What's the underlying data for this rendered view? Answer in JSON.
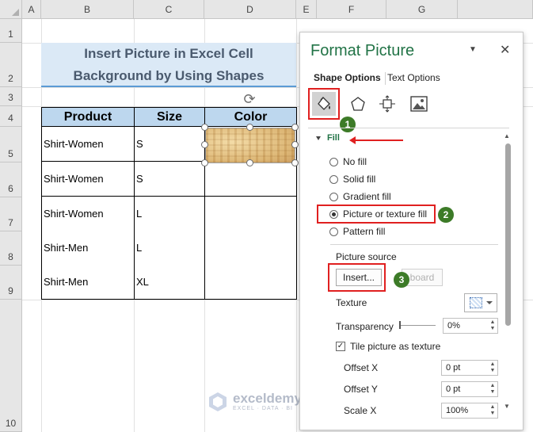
{
  "columns": [
    "A",
    "B",
    "C",
    "D",
    "E",
    "F",
    "G"
  ],
  "rows": [
    "1",
    "2",
    "3",
    "4",
    "5",
    "6",
    "7",
    "8",
    "9",
    "10"
  ],
  "sheet_title_line1": "Insert Picture in Excel Cell",
  "sheet_title_line2": "Background by Using Shapes",
  "table": {
    "headers": [
      "Product",
      "Size",
      "Color"
    ],
    "rows": [
      {
        "product": "Shirt-Women",
        "size": "S"
      },
      {
        "product": "Shirt-Women",
        "size": "S"
      },
      {
        "product": "Shirt-Women",
        "size": "L"
      },
      {
        "product": "Shirt-Men",
        "size": "L"
      },
      {
        "product": "Shirt-Men",
        "size": "XL"
      }
    ]
  },
  "watermark": {
    "name": "exceldemy",
    "tagline": "EXCEL · DATA · BI"
  },
  "pane": {
    "title": "Format Picture",
    "menu_glyph": "▼",
    "close_glyph": "✕",
    "tabs": {
      "shape": "Shape Options",
      "text": "Text Options"
    },
    "fill_section": "Fill",
    "fill_options": [
      "No fill",
      "Solid fill",
      "Gradient fill",
      "Picture or texture fill",
      "Pattern fill"
    ],
    "selected_fill": "Picture or texture fill",
    "picture_source_label": "Picture source",
    "insert_button": "Insert...",
    "clipboard_button": "board",
    "texture_label": "Texture",
    "transparency_label": "Transparency",
    "transparency_value": "0%",
    "tile_label": "Tile picture as texture",
    "tile_checked": true,
    "offset_x_label": "Offset X",
    "offset_x_value": "0 pt",
    "offset_y_label": "Offset Y",
    "offset_y_value": "0 pt",
    "scale_x_label": "Scale X",
    "scale_x_value": "100%"
  },
  "steps": [
    "1",
    "2",
    "3"
  ],
  "colors": {
    "accent_green": "#217346",
    "highlight_red": "#e02020",
    "badge_green": "#3d7b28",
    "header_blue": "#bdd7ee",
    "title_blue": "#dbe9f6"
  }
}
